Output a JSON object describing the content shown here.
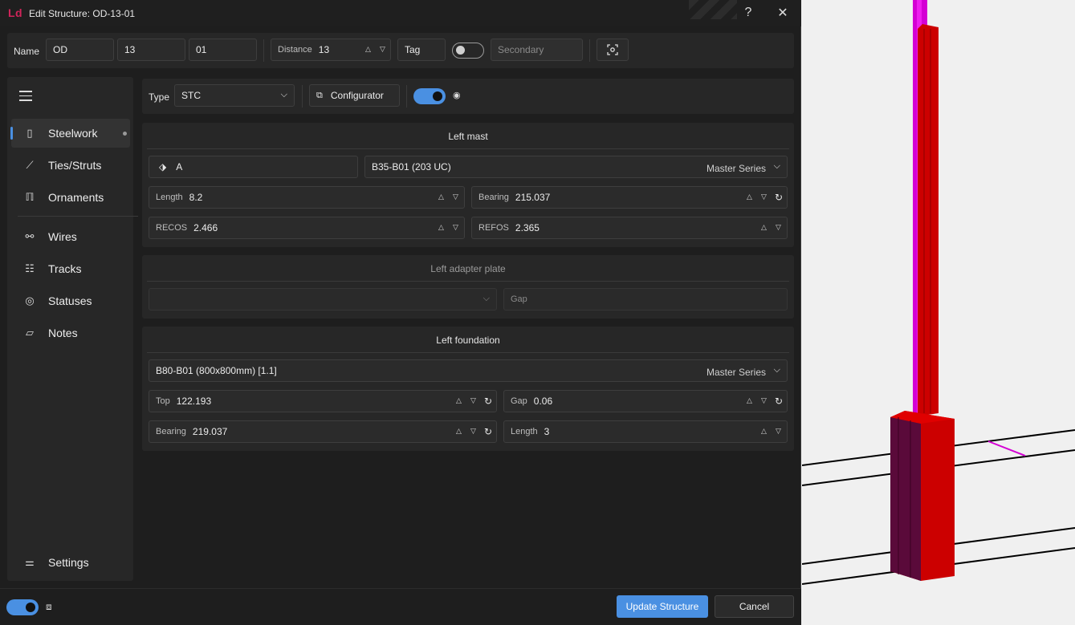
{
  "window": {
    "logo": "Ld",
    "title": "Edit Structure: OD-13-01",
    "help_icon": "?",
    "close_icon": "✕"
  },
  "topbar": {
    "name_label": "Name",
    "name_part1": "OD",
    "name_part2": "13",
    "name_part3": "01",
    "distance_label": "Distance",
    "distance_value": "13",
    "tag_label": "Tag",
    "secondary_toggle_on": false,
    "secondary_placeholder": "Secondary"
  },
  "sidebar": {
    "menu_icon": "hamburger-icon",
    "items": [
      {
        "label": "Steelwork",
        "icon": "steelwork-icon",
        "active": true
      },
      {
        "label": "Ties/Struts",
        "icon": "ties-icon"
      },
      {
        "label": "Ornaments",
        "icon": "ornaments-icon"
      },
      {
        "label": "Wires",
        "icon": "wires-icon"
      },
      {
        "label": "Tracks",
        "icon": "tracks-icon"
      },
      {
        "label": "Statuses",
        "icon": "statuses-icon"
      },
      {
        "label": "Notes",
        "icon": "notes-icon"
      }
    ],
    "settings_label": "Settings"
  },
  "type_row": {
    "type_label": "Type",
    "type_value": "STC",
    "configurator_label": "Configurator",
    "toggle_on": true
  },
  "left_mast": {
    "title": "Left mast",
    "tag_value": "A",
    "section_value": "B35-B01 (203 UC)",
    "series_value": "Master Series",
    "length_label": "Length",
    "length_value": "8.2",
    "bearing_label": "Bearing",
    "bearing_value": "215.037",
    "recos_label": "RECOS",
    "recos_value": "2.466",
    "refos_label": "REFOS",
    "refos_value": "2.365"
  },
  "left_adapter_plate": {
    "title": "Left adapter plate",
    "select_value": "",
    "gap_placeholder": "Gap"
  },
  "left_foundation": {
    "title": "Left foundation",
    "foundation_value": "B80-B01 (800x800mm) [1.1]",
    "series_value": "Master Series",
    "top_label": "Top",
    "top_value": "122.193",
    "gap_label": "Gap",
    "gap_value": "0.06",
    "bearing_label": "Bearing",
    "bearing_value": "219.037",
    "length_label": "Length",
    "length_value": "3"
  },
  "footer": {
    "toggle_on": true,
    "update_label": "Update Structure",
    "cancel_label": "Cancel"
  },
  "colors": {
    "accent": "#4a90e2",
    "logo": "#d1245a",
    "mast_red": "#cc0000",
    "mast_magenta": "#d400d4"
  }
}
